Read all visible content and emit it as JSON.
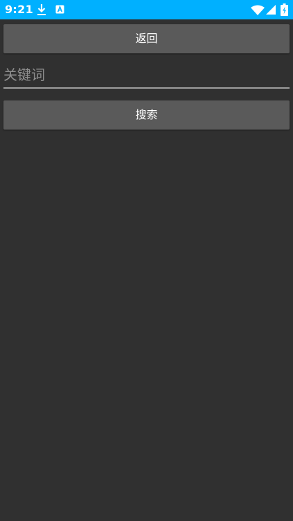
{
  "status_bar": {
    "time": "9:21",
    "background_color": "#00B0FF",
    "icons": [
      "download-icon",
      "a-icon",
      "wifi-icon",
      "signal-icon",
      "battery-icon"
    ]
  },
  "back_button": {
    "label": "返回"
  },
  "keyword_input": {
    "value": "",
    "placeholder": "关键词"
  },
  "search_button": {
    "label": "搜索"
  },
  "colors": {
    "background": "#303030",
    "button": "#5A5A5A",
    "input_underline": "#9E9E9E"
  }
}
